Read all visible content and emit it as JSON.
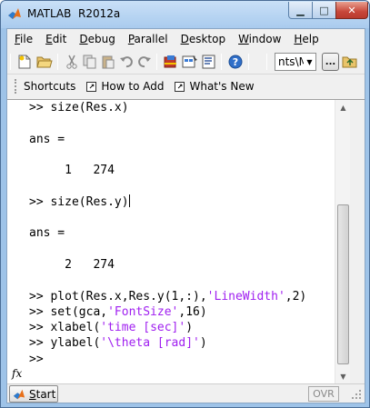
{
  "window": {
    "app_name": "MATLAB",
    "version": "R2012a",
    "minimize_glyph": "▁",
    "maximize_glyph": "□",
    "close_glyph": "✕"
  },
  "menubar": {
    "items": [
      "File",
      "Edit",
      "Debug",
      "Parallel",
      "Desktop",
      "Window",
      "Help"
    ]
  },
  "toolbar": {
    "icons": [
      "new-file-icon",
      "open-folder-icon",
      "cut-icon",
      "copy-icon",
      "paste-icon",
      "undo-icon",
      "redo-icon",
      "simulink-icon",
      "guide-icon",
      "profiler-icon",
      "help-icon"
    ],
    "current_folder_value": "nts\\M",
    "browse_label": "..."
  },
  "shortcuts": {
    "title": "Shortcuts",
    "items": [
      "How to Add",
      "What's New"
    ]
  },
  "command_window": {
    "lines": [
      [
        {
          "t": ">> size(Res.x)"
        }
      ],
      [],
      [
        {
          "t": "ans ="
        }
      ],
      [],
      [
        {
          "t": "     1   274"
        }
      ],
      [],
      [
        {
          "t": ">> size(Res.y)"
        }
      ],
      [],
      [
        {
          "t": "ans ="
        }
      ],
      [],
      [
        {
          "t": "     2   274"
        }
      ],
      [],
      [
        {
          "t": ">> plot(Res.x,Res.y(1,:),"
        },
        {
          "t": "'LineWidth'",
          "s": true
        },
        {
          "t": ",2)"
        }
      ],
      [
        {
          "t": ">> set(gca,"
        },
        {
          "t": "'FontSize'",
          "s": true
        },
        {
          "t": ",16)"
        }
      ],
      [
        {
          "t": ">> xlabel("
        },
        {
          "t": "'time [sec]'",
          "s": true
        },
        {
          "t": ")"
        }
      ],
      [
        {
          "t": ">> ylabel("
        },
        {
          "t": "'\\theta [rad]'",
          "s": true
        },
        {
          "t": ")"
        }
      ],
      [
        {
          "t": ">> "
        }
      ]
    ],
    "string_color": "#a020f0",
    "fx_label": "fx"
  },
  "statusbar": {
    "start_label": "Start",
    "ovr_label": "OVR"
  },
  "colors": {
    "titlebar": "#b4d2f0",
    "close_button": "#c8473a",
    "matlab_orange": "#e8701a"
  }
}
